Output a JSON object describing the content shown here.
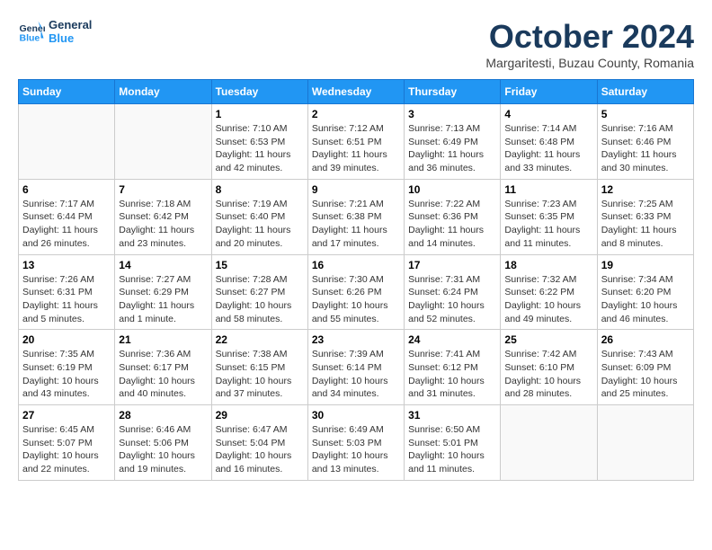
{
  "header": {
    "logo_line1": "General",
    "logo_line2": "Blue",
    "month": "October 2024",
    "location": "Margaritesti, Buzau County, Romania"
  },
  "weekdays": [
    "Sunday",
    "Monday",
    "Tuesday",
    "Wednesday",
    "Thursday",
    "Friday",
    "Saturday"
  ],
  "weeks": [
    [
      {
        "day": "",
        "empty": true
      },
      {
        "day": "",
        "empty": true
      },
      {
        "day": "1",
        "sunrise": "Sunrise: 7:10 AM",
        "sunset": "Sunset: 6:53 PM",
        "daylight": "Daylight: 11 hours and 42 minutes."
      },
      {
        "day": "2",
        "sunrise": "Sunrise: 7:12 AM",
        "sunset": "Sunset: 6:51 PM",
        "daylight": "Daylight: 11 hours and 39 minutes."
      },
      {
        "day": "3",
        "sunrise": "Sunrise: 7:13 AM",
        "sunset": "Sunset: 6:49 PM",
        "daylight": "Daylight: 11 hours and 36 minutes."
      },
      {
        "day": "4",
        "sunrise": "Sunrise: 7:14 AM",
        "sunset": "Sunset: 6:48 PM",
        "daylight": "Daylight: 11 hours and 33 minutes."
      },
      {
        "day": "5",
        "sunrise": "Sunrise: 7:16 AM",
        "sunset": "Sunset: 6:46 PM",
        "daylight": "Daylight: 11 hours and 30 minutes."
      }
    ],
    [
      {
        "day": "6",
        "sunrise": "Sunrise: 7:17 AM",
        "sunset": "Sunset: 6:44 PM",
        "daylight": "Daylight: 11 hours and 26 minutes."
      },
      {
        "day": "7",
        "sunrise": "Sunrise: 7:18 AM",
        "sunset": "Sunset: 6:42 PM",
        "daylight": "Daylight: 11 hours and 23 minutes."
      },
      {
        "day": "8",
        "sunrise": "Sunrise: 7:19 AM",
        "sunset": "Sunset: 6:40 PM",
        "daylight": "Daylight: 11 hours and 20 minutes."
      },
      {
        "day": "9",
        "sunrise": "Sunrise: 7:21 AM",
        "sunset": "Sunset: 6:38 PM",
        "daylight": "Daylight: 11 hours and 17 minutes."
      },
      {
        "day": "10",
        "sunrise": "Sunrise: 7:22 AM",
        "sunset": "Sunset: 6:36 PM",
        "daylight": "Daylight: 11 hours and 14 minutes."
      },
      {
        "day": "11",
        "sunrise": "Sunrise: 7:23 AM",
        "sunset": "Sunset: 6:35 PM",
        "daylight": "Daylight: 11 hours and 11 minutes."
      },
      {
        "day": "12",
        "sunrise": "Sunrise: 7:25 AM",
        "sunset": "Sunset: 6:33 PM",
        "daylight": "Daylight: 11 hours and 8 minutes."
      }
    ],
    [
      {
        "day": "13",
        "sunrise": "Sunrise: 7:26 AM",
        "sunset": "Sunset: 6:31 PM",
        "daylight": "Daylight: 11 hours and 5 minutes."
      },
      {
        "day": "14",
        "sunrise": "Sunrise: 7:27 AM",
        "sunset": "Sunset: 6:29 PM",
        "daylight": "Daylight: 11 hours and 1 minute."
      },
      {
        "day": "15",
        "sunrise": "Sunrise: 7:28 AM",
        "sunset": "Sunset: 6:27 PM",
        "daylight": "Daylight: 10 hours and 58 minutes."
      },
      {
        "day": "16",
        "sunrise": "Sunrise: 7:30 AM",
        "sunset": "Sunset: 6:26 PM",
        "daylight": "Daylight: 10 hours and 55 minutes."
      },
      {
        "day": "17",
        "sunrise": "Sunrise: 7:31 AM",
        "sunset": "Sunset: 6:24 PM",
        "daylight": "Daylight: 10 hours and 52 minutes."
      },
      {
        "day": "18",
        "sunrise": "Sunrise: 7:32 AM",
        "sunset": "Sunset: 6:22 PM",
        "daylight": "Daylight: 10 hours and 49 minutes."
      },
      {
        "day": "19",
        "sunrise": "Sunrise: 7:34 AM",
        "sunset": "Sunset: 6:20 PM",
        "daylight": "Daylight: 10 hours and 46 minutes."
      }
    ],
    [
      {
        "day": "20",
        "sunrise": "Sunrise: 7:35 AM",
        "sunset": "Sunset: 6:19 PM",
        "daylight": "Daylight: 10 hours and 43 minutes."
      },
      {
        "day": "21",
        "sunrise": "Sunrise: 7:36 AM",
        "sunset": "Sunset: 6:17 PM",
        "daylight": "Daylight: 10 hours and 40 minutes."
      },
      {
        "day": "22",
        "sunrise": "Sunrise: 7:38 AM",
        "sunset": "Sunset: 6:15 PM",
        "daylight": "Daylight: 10 hours and 37 minutes."
      },
      {
        "day": "23",
        "sunrise": "Sunrise: 7:39 AM",
        "sunset": "Sunset: 6:14 PM",
        "daylight": "Daylight: 10 hours and 34 minutes."
      },
      {
        "day": "24",
        "sunrise": "Sunrise: 7:41 AM",
        "sunset": "Sunset: 6:12 PM",
        "daylight": "Daylight: 10 hours and 31 minutes."
      },
      {
        "day": "25",
        "sunrise": "Sunrise: 7:42 AM",
        "sunset": "Sunset: 6:10 PM",
        "daylight": "Daylight: 10 hours and 28 minutes."
      },
      {
        "day": "26",
        "sunrise": "Sunrise: 7:43 AM",
        "sunset": "Sunset: 6:09 PM",
        "daylight": "Daylight: 10 hours and 25 minutes."
      }
    ],
    [
      {
        "day": "27",
        "sunrise": "Sunrise: 6:45 AM",
        "sunset": "Sunset: 5:07 PM",
        "daylight": "Daylight: 10 hours and 22 minutes."
      },
      {
        "day": "28",
        "sunrise": "Sunrise: 6:46 AM",
        "sunset": "Sunset: 5:06 PM",
        "daylight": "Daylight: 10 hours and 19 minutes."
      },
      {
        "day": "29",
        "sunrise": "Sunrise: 6:47 AM",
        "sunset": "Sunset: 5:04 PM",
        "daylight": "Daylight: 10 hours and 16 minutes."
      },
      {
        "day": "30",
        "sunrise": "Sunrise: 6:49 AM",
        "sunset": "Sunset: 5:03 PM",
        "daylight": "Daylight: 10 hours and 13 minutes."
      },
      {
        "day": "31",
        "sunrise": "Sunrise: 6:50 AM",
        "sunset": "Sunset: 5:01 PM",
        "daylight": "Daylight: 10 hours and 11 minutes."
      },
      {
        "day": "",
        "empty": true
      },
      {
        "day": "",
        "empty": true
      }
    ]
  ]
}
